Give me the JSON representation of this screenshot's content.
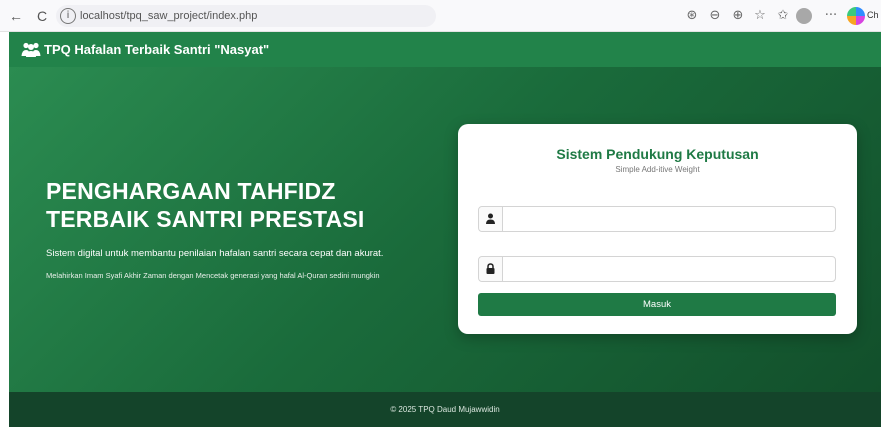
{
  "browser": {
    "url": "localhost/tpq_saw_project/index.php",
    "back_icon": "←",
    "reload_icon": "C",
    "info_icon": "i",
    "toolbar_icons": [
      "read-aloud",
      "zoom",
      "favorites-add",
      "favorites",
      "collections",
      "profile",
      "more",
      "copilot"
    ],
    "extension_label": "Ch"
  },
  "navbar": {
    "brand": "TPQ Hafalan Terbaik Santri \"Nasyat\"",
    "brand_icon": "users-icon",
    "color": "#22834a"
  },
  "hero": {
    "title_line1": "PENGHARGAAN TAHFIDZ",
    "title_line2": "TERBAIK SANTRI PRESTASI",
    "subtitle": "Sistem digital untuk membantu penilaian hafalan santri secara cepat dan akurat.",
    "note": "Melahirkan Imam Syafi Akhir Zaman dengan Mencetak generasi yang hafal Al-Quran sedini mungkin"
  },
  "login": {
    "title": "Sistem Pendukung Keputusan",
    "subtitle": "Simple Add-itive Weight",
    "username_value": "",
    "password_value": "",
    "button": "Masuk"
  },
  "footer": {
    "text": "© 2025 TPQ Daud Mujawwidin"
  },
  "colors": {
    "primary": "#22834a",
    "title_green": "#1f7a45",
    "footer": "#14442a"
  }
}
